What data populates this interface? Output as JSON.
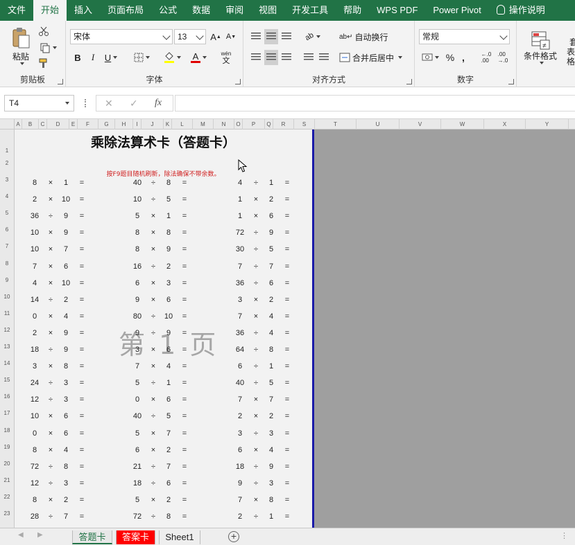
{
  "menu": [
    "文件",
    "开始",
    "插入",
    "页面布局",
    "公式",
    "数据",
    "审阅",
    "视图",
    "开发工具",
    "帮助",
    "WPS PDF",
    "Power Pivot",
    "操作说明"
  ],
  "menu_active": "开始",
  "ribbon": {
    "clipboard": {
      "paste": "粘贴",
      "label": "剪贴板"
    },
    "font": {
      "name": "宋体",
      "size": "13",
      "bold": "B",
      "italic": "I",
      "underline": "U",
      "grow": "A",
      "shrink": "A",
      "pinyin": "wén",
      "pinyin_char": "文",
      "label": "字体"
    },
    "alignment": {
      "wrap": "自动换行",
      "merge": "合并后居中",
      "label": "对齐方式"
    },
    "number": {
      "format": "常规",
      "percent": "%",
      "comma": ",",
      "inc_decimal": "←.0\n.00",
      "label": "数字"
    },
    "styles": {
      "conditional": "条件格式",
      "table_partial": "套",
      "table_partial2": "表格"
    }
  },
  "formula_bar": {
    "name_box": "T4",
    "cancel": "✕",
    "confirm": "✓",
    "fx": "fx",
    "formula": ""
  },
  "columns": [
    "A",
    "B",
    "C",
    "D",
    "E",
    "F",
    "G",
    "H",
    "I",
    "J",
    "K",
    "L",
    "M",
    "N",
    "O",
    "P",
    "Q",
    "R",
    "S",
    "T",
    "U",
    "V",
    "W",
    "X",
    "Y"
  ],
  "rows": [
    "1",
    "2",
    "3",
    "4",
    "5",
    "6",
    "7",
    "8",
    "9",
    "10",
    "11",
    "12",
    "13",
    "14",
    "15",
    "16",
    "17",
    "18",
    "19",
    "20",
    "21",
    "22",
    "23"
  ],
  "sheet": {
    "title": "乘除法算术卡（答题卡）",
    "subtitle": "按F9题目随机刷新，除法确保不带余数。",
    "watermark": "第 1 页",
    "equals": "=",
    "problems": [
      [
        [
          "8",
          "×",
          "1"
        ],
        [
          "40",
          "÷",
          "8"
        ],
        [
          "4",
          "÷",
          "1"
        ]
      ],
      [
        [
          "2",
          "×",
          "10"
        ],
        [
          "10",
          "÷",
          "5"
        ],
        [
          "1",
          "×",
          "2"
        ]
      ],
      [
        [
          "36",
          "÷",
          "9"
        ],
        [
          "5",
          "×",
          "1"
        ],
        [
          "1",
          "×",
          "6"
        ]
      ],
      [
        [
          "10",
          "×",
          "9"
        ],
        [
          "8",
          "×",
          "8"
        ],
        [
          "72",
          "÷",
          "9"
        ]
      ],
      [
        [
          "10",
          "×",
          "7"
        ],
        [
          "8",
          "×",
          "9"
        ],
        [
          "30",
          "÷",
          "5"
        ]
      ],
      [
        [
          "7",
          "×",
          "6"
        ],
        [
          "16",
          "÷",
          "2"
        ],
        [
          "7",
          "÷",
          "7"
        ]
      ],
      [
        [
          "4",
          "×",
          "10"
        ],
        [
          "6",
          "×",
          "3"
        ],
        [
          "36",
          "÷",
          "6"
        ]
      ],
      [
        [
          "14",
          "÷",
          "2"
        ],
        [
          "9",
          "×",
          "6"
        ],
        [
          "3",
          "×",
          "2"
        ]
      ],
      [
        [
          "0",
          "×",
          "4"
        ],
        [
          "80",
          "÷",
          "10"
        ],
        [
          "7",
          "×",
          "4"
        ]
      ],
      [
        [
          "2",
          "×",
          "9"
        ],
        [
          "9",
          "÷",
          "9"
        ],
        [
          "36",
          "÷",
          "4"
        ]
      ],
      [
        [
          "18",
          "÷",
          "9"
        ],
        [
          "3",
          "×",
          "6"
        ],
        [
          "64",
          "÷",
          "8"
        ]
      ],
      [
        [
          "3",
          "×",
          "8"
        ],
        [
          "7",
          "×",
          "4"
        ],
        [
          "6",
          "÷",
          "1"
        ]
      ],
      [
        [
          "24",
          "÷",
          "3"
        ],
        [
          "5",
          "÷",
          "1"
        ],
        [
          "40",
          "÷",
          "5"
        ]
      ],
      [
        [
          "12",
          "÷",
          "3"
        ],
        [
          "0",
          "×",
          "6"
        ],
        [
          "7",
          "×",
          "7"
        ]
      ],
      [
        [
          "10",
          "×",
          "6"
        ],
        [
          "40",
          "÷",
          "5"
        ],
        [
          "2",
          "×",
          "2"
        ]
      ],
      [
        [
          "0",
          "×",
          "6"
        ],
        [
          "5",
          "×",
          "7"
        ],
        [
          "3",
          "÷",
          "3"
        ]
      ],
      [
        [
          "8",
          "×",
          "4"
        ],
        [
          "6",
          "×",
          "2"
        ],
        [
          "6",
          "×",
          "4"
        ]
      ],
      [
        [
          "72",
          "÷",
          "8"
        ],
        [
          "21",
          "÷",
          "7"
        ],
        [
          "18",
          "÷",
          "9"
        ]
      ],
      [
        [
          "12",
          "÷",
          "3"
        ],
        [
          "18",
          "÷",
          "6"
        ],
        [
          "9",
          "÷",
          "3"
        ]
      ],
      [
        [
          "8",
          "×",
          "2"
        ],
        [
          "5",
          "×",
          "2"
        ],
        [
          "7",
          "×",
          "8"
        ]
      ],
      [
        [
          "28",
          "÷",
          "7"
        ],
        [
          "72",
          "÷",
          "8"
        ],
        [
          "2",
          "÷",
          "1"
        ]
      ]
    ]
  },
  "tabs": [
    {
      "label": "答题卡",
      "bg": "#e8e8e8",
      "color": "#217346",
      "active": true
    },
    {
      "label": "答案卡",
      "bg": "#ff0000",
      "color": "#ffffff",
      "active": false
    },
    {
      "label": "Sheet1",
      "bg": "#eeeeee",
      "color": "#222222",
      "active": false
    }
  ],
  "add_sheet": "+"
}
